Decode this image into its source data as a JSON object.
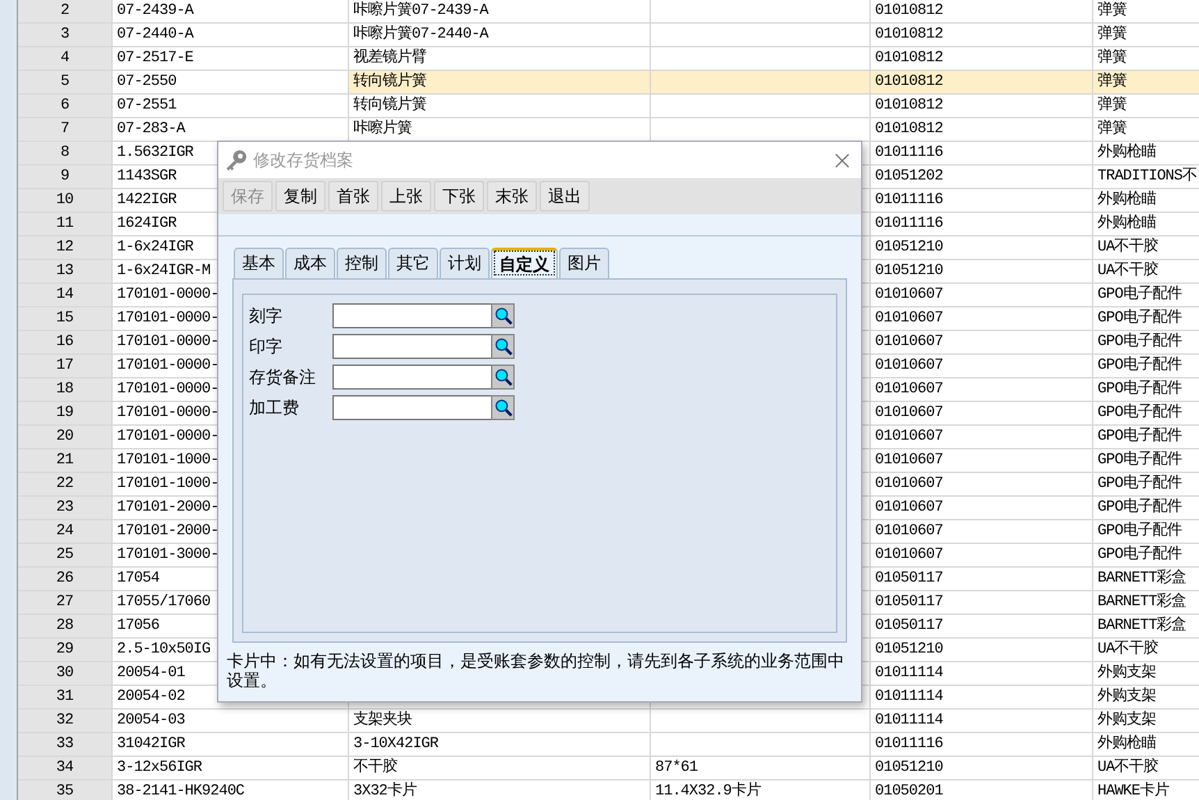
{
  "table": {
    "rows": [
      {
        "number": "2",
        "column_2": "07-2439-A",
        "column_3": "咔嚓片簧07-2439-A",
        "column_5": "01010812",
        "column_6": "弹簧",
        "selected": false
      },
      {
        "number": "3",
        "column_2": "07-2440-A",
        "column_3": "咔嚓片簧07-2440-A",
        "column_5": "01010812",
        "column_6": "弹簧",
        "selected": false
      },
      {
        "number": "4",
        "column_2": "07-2517-E",
        "column_3": "视差镜片臂",
        "column_5": "01010812",
        "column_6": "弹簧",
        "selected": false
      },
      {
        "number": "5",
        "column_2": "07-2550",
        "column_3": "转向镜片簧",
        "column_5": "01010812",
        "column_6": "弹簧",
        "selected": true
      },
      {
        "number": "6",
        "column_2": "07-2551",
        "column_3": "转向镜片簧",
        "column_5": "01010812",
        "column_6": "弹簧",
        "selected": false
      },
      {
        "number": "7",
        "column_2": "07-283-A",
        "column_3": "咔嚓片簧",
        "column_5": "01010812",
        "column_6": "弹簧",
        "selected": false
      },
      {
        "number": "8",
        "column_2": "1.5632IGR",
        "column_5": "01011116",
        "column_6": "外购枪瞄",
        "selected": false
      },
      {
        "number": "9",
        "column_2": "1143SGR",
        "column_5": "01051202",
        "column_6": "TRADITIONS不",
        "selected": false
      },
      {
        "number": "10",
        "column_2": "1422IGR",
        "column_5": "01011116",
        "column_6": "外购枪瞄",
        "selected": false
      },
      {
        "number": "11",
        "column_2": "1624IGR",
        "column_5": "01011116",
        "column_6": "外购枪瞄",
        "selected": false
      },
      {
        "number": "12",
        "column_2": "1-6x24IGR",
        "column_5": "01051210",
        "column_6": "UA不干胶",
        "selected": false
      },
      {
        "number": "13",
        "column_2": "1-6x24IGR-M",
        "column_5": "01051210",
        "column_6": "UA不干胶",
        "selected": false
      },
      {
        "number": "14",
        "column_2": "170101-0000-",
        "column_5": "01010607",
        "column_6": "GPO电子配件",
        "selected": false
      },
      {
        "number": "15",
        "column_2": "170101-0000-",
        "column_5": "01010607",
        "column_6": "GPO电子配件",
        "selected": false
      },
      {
        "number": "16",
        "column_2": "170101-0000-",
        "column_5": "01010607",
        "column_6": "GPO电子配件",
        "selected": false
      },
      {
        "number": "17",
        "column_2": "170101-0000-",
        "column_5": "01010607",
        "column_6": "GPO电子配件",
        "selected": false
      },
      {
        "number": "18",
        "column_2": "170101-0000-",
        "column_5": "01010607",
        "column_6": "GPO电子配件",
        "selected": false
      },
      {
        "number": "19",
        "column_2": "170101-0000-",
        "column_5": "01010607",
        "column_6": "GPO电子配件",
        "selected": false
      },
      {
        "number": "20",
        "column_2": "170101-0000-",
        "column_5": "01010607",
        "column_6": "GPO电子配件",
        "selected": false
      },
      {
        "number": "21",
        "column_2": "170101-1000-",
        "column_5": "01010607",
        "column_6": "GPO电子配件",
        "selected": false
      },
      {
        "number": "22",
        "column_2": "170101-1000-",
        "column_5": "01010607",
        "column_6": "GPO电子配件",
        "selected": false
      },
      {
        "number": "23",
        "column_2": "170101-2000-",
        "column_5": "01010607",
        "column_6": "GPO电子配件",
        "selected": false
      },
      {
        "number": "24",
        "column_2": "170101-2000-",
        "column_5": "01010607",
        "column_6": "GPO电子配件",
        "selected": false
      },
      {
        "number": "25",
        "column_2": "170101-3000-",
        "column_5": "01010607",
        "column_6": "GPO电子配件",
        "selected": false
      },
      {
        "number": "26",
        "column_2": "17054",
        "column_5": "01050117",
        "column_6": "BARNETT彩盒",
        "selected": false
      },
      {
        "number": "27",
        "column_2": "17055/17060",
        "column_5": "01050117",
        "column_6": "BARNETT彩盒",
        "selected": false
      },
      {
        "number": "28",
        "column_2": "17056",
        "column_5": "01050117",
        "column_6": "BARNETT彩盒",
        "selected": false
      },
      {
        "number": "29",
        "column_2": "2.5-10x50IG",
        "column_5": "01051210",
        "column_6": "UA不干胶",
        "selected": false
      },
      {
        "number": "30",
        "column_2": "20054-01",
        "column_5": "01011114",
        "column_6": "外购支架",
        "selected": false
      },
      {
        "number": "31",
        "column_2": "20054-02",
        "column_5": "01011114",
        "column_6": "外购支架",
        "selected": false
      },
      {
        "number": "32",
        "column_2": "20054-03",
        "column_3": "支架夹块",
        "column_5": "01011114",
        "column_6": "外购支架",
        "selected": false
      },
      {
        "number": "33",
        "column_2": "31042IGR",
        "column_3": "3-10X42IGR",
        "column_5": "01011116",
        "column_6": "外购枪瞄",
        "selected": false
      },
      {
        "number": "34",
        "column_2": "3-12x56IGR",
        "column_3": "不干胶",
        "column_4": "87*61",
        "column_5": "01051210",
        "column_6": "UA不干胶",
        "selected": false
      },
      {
        "number": "35",
        "column_2": "38-2141-HK9240C",
        "column_3": "3X32卡片",
        "column_4": "11.4X32.9卡片",
        "column_5": "01050201",
        "column_6": "HAWKE卡片",
        "selected": false
      }
    ]
  },
  "dialog": {
    "title": "修改存货档案",
    "toolbar": [
      {
        "label": "保存",
        "disabled": true
      },
      {
        "label": "复制",
        "disabled": false
      },
      {
        "label": "首张",
        "disabled": false
      },
      {
        "label": "上张",
        "disabled": false
      },
      {
        "label": "下张",
        "disabled": false
      },
      {
        "label": "末张",
        "disabled": false
      },
      {
        "label": "退出",
        "disabled": false
      }
    ],
    "tabs": [
      {
        "label": "基本",
        "selected": false
      },
      {
        "label": "成本",
        "selected": false
      },
      {
        "label": "控制",
        "selected": false
      },
      {
        "label": "其它",
        "selected": false
      },
      {
        "label": "计划",
        "selected": false
      },
      {
        "label": "自定义",
        "selected": true
      },
      {
        "label": "图片",
        "selected": false
      }
    ],
    "fields": [
      {
        "label": "刻字"
      },
      {
        "label": "印字"
      },
      {
        "label": "存货备注"
      },
      {
        "label": "加工费"
      }
    ],
    "note": "卡片中：如有无法设置的项目，是受账套参数的控制，请先到各子系统的业务范围中设置。"
  }
}
